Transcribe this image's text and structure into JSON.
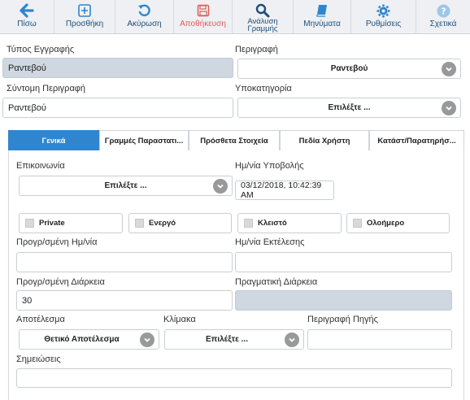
{
  "toolbar": {
    "back": "Πίσω",
    "add": "Προσθήκη",
    "cancel": "Ακύρωση",
    "save": "Αποθήκευση",
    "line_analysis_1": "Ανάλυση",
    "line_analysis_2": "Γραμμής",
    "messages": "Μηνύματα",
    "settings": "Ρυθμίσεις",
    "about": "Σχετικά"
  },
  "colors": {
    "accent": "#2f86cf",
    "icon_blue": "#2f86cf",
    "save_red": "#e05a5a",
    "readonly_bg": "#cfd8e1"
  },
  "header_form": {
    "record_type_label": "Τύπος Εγγραφής",
    "record_type_value": "Ραντεβού",
    "description_label": "Περιγραφή",
    "description_value": "Ραντεβού",
    "short_description_label": "Σύντομη Περιγραφή",
    "short_description_value": "Ραντεβού",
    "subcategory_label": "Υποκατηγορία",
    "subcategory_value": "Επιλέξτε ..."
  },
  "tabs": [
    "Γενικά",
    "Γραμμές Παραστατι...",
    "Πρόσθετα Στοιχεία",
    "Πεδία Χρήστη",
    "Κατάστ/Παρατηρήσ..."
  ],
  "general": {
    "communication_label": "Επικοινωνία",
    "communication_value": "Επιλέξτε ...",
    "submission_date_label": "Ημ/νία Υποβολής",
    "submission_date_value": "03/12/2018, 10:42:39 AM",
    "private_label": "Private",
    "active_label": "Ενεργό",
    "closed_label": "Κλειστό",
    "allday_label": "Ολοήμερο",
    "planned_date_label": "Προγρ/σμένη Ημ/νία",
    "planned_date_value": "",
    "execution_date_label": "Ημ/νία Εκτέλεσης",
    "execution_date_value": "",
    "planned_duration_label": "Προγρ/σμένη Διάρκεια",
    "planned_duration_value": "30",
    "actual_duration_label": "Πραγματική Διάρκεια",
    "actual_duration_value": "",
    "result_label": "Αποτέλεσμα",
    "result_value": "Θετικό Αποτέλεσμα",
    "scale_label": "Κλίμακα",
    "scale_value": "Επιλέξτε ...",
    "source_description_label": "Περιγραφή Πηγής",
    "source_description_value": "",
    "notes_label": "Σημειώσεις",
    "notes_value": ""
  }
}
